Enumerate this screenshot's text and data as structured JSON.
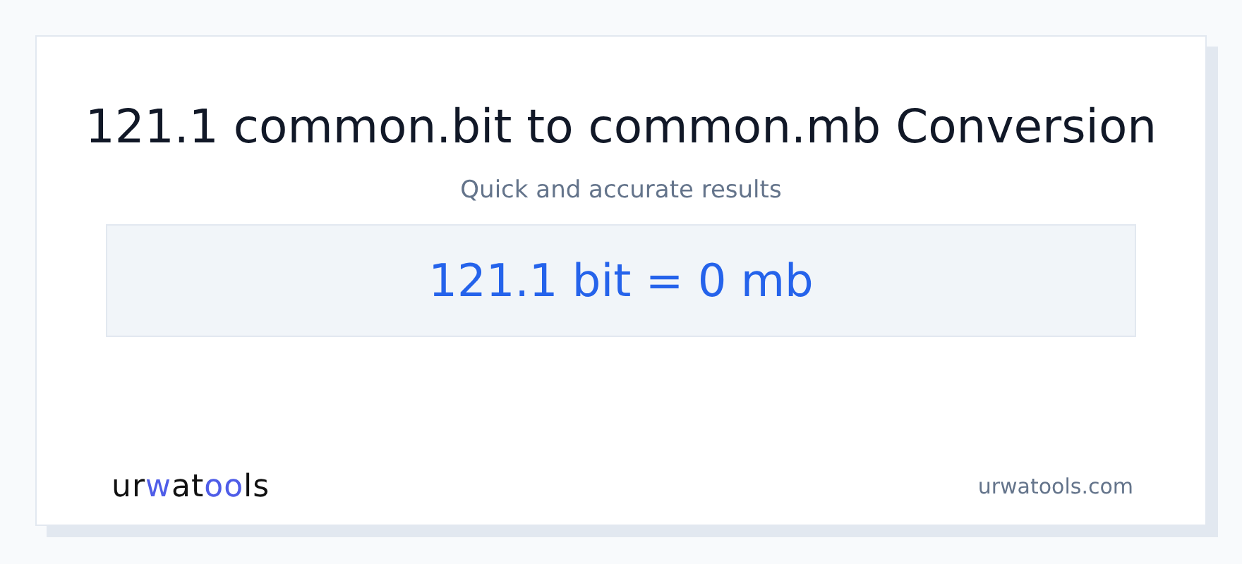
{
  "title": "121.1 common.bit to common.mb Conversion",
  "subtitle": "Quick and accurate results",
  "result": "121.1 bit = 0 mb",
  "logo": [
    {
      "text": "ur",
      "accent": false
    },
    {
      "text": "w",
      "accent": true
    },
    {
      "text": "at",
      "accent": false
    },
    {
      "text": "oo",
      "accent": true
    },
    {
      "text": "ls",
      "accent": false
    }
  ],
  "site": "urwatools.com"
}
